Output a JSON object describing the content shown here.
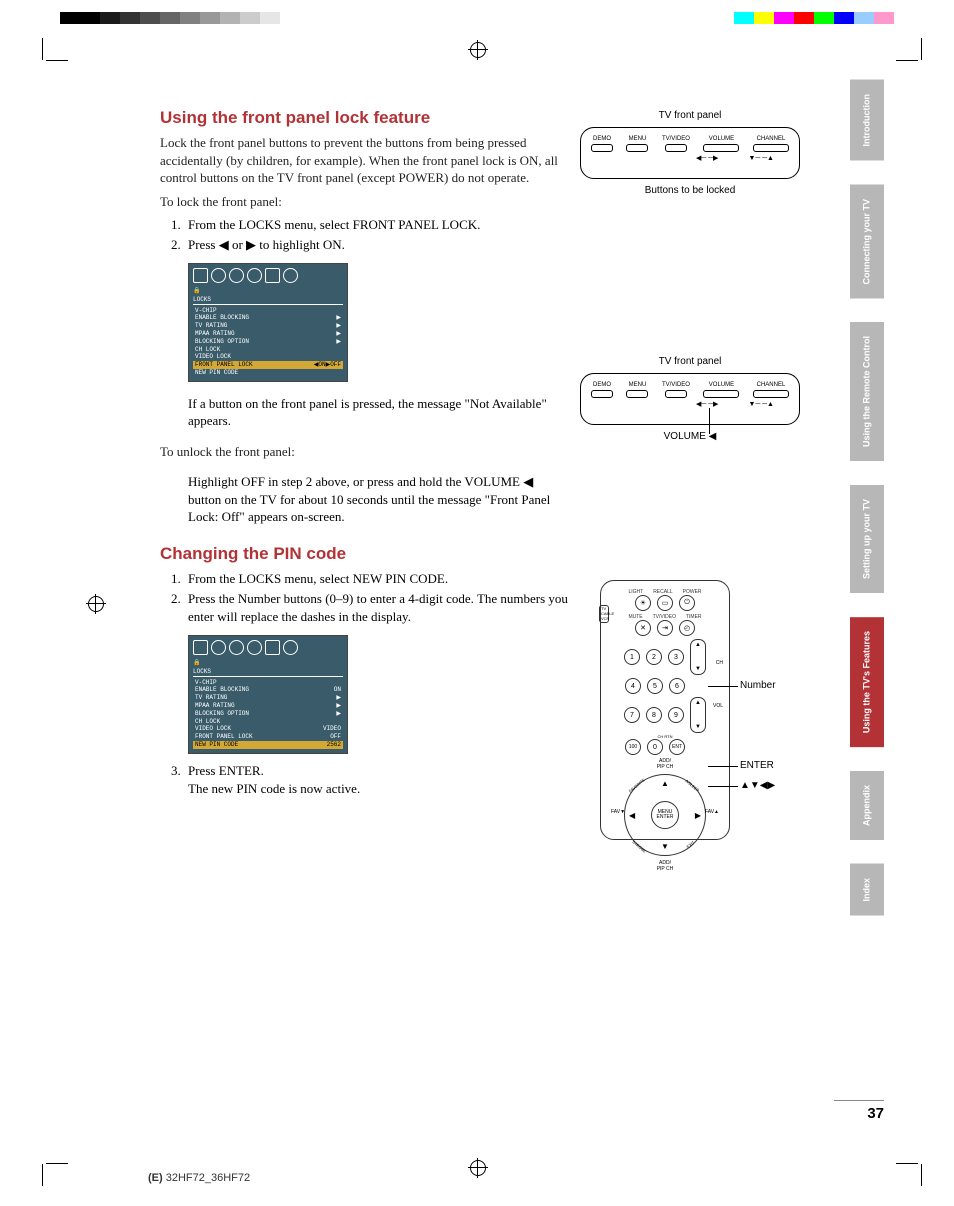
{
  "section1": {
    "title": "Using the front panel lock feature",
    "intro": "Lock the front panel buttons to prevent the buttons from being pressed accidentally (by children, for example). When the front panel lock is ON, all control buttons on the TV front panel (except POWER) do not operate.",
    "lockLead": "To lock the front panel:",
    "step1": "From the LOCKS menu, select FRONT PANEL LOCK.",
    "step2": "Press ◀ or ▶ to highlight ON.",
    "afterImg": "If a button on the front panel is pressed, the message \"Not Available\" appears.",
    "unlockLead": "To unlock the front panel:",
    "unlockPara": "Highlight OFF in step 2 above, or press and hold the VOLUME ◀ button on the TV for about 10 seconds until the message \"Front Panel Lock: Off\" appears on-screen."
  },
  "section2": {
    "title": "Changing the PIN code",
    "step1": "From the LOCKS menu, select NEW PIN CODE.",
    "step2": "Press the Number buttons (0–9) to enter a 4-digit code. The numbers you enter will replace the dashes in the display.",
    "step3": "Press ENTER.",
    "step3b": "The new PIN code is now active."
  },
  "osd1": {
    "title": "LOCKS",
    "rows": [
      {
        "l": "V-CHIP",
        "r": ""
      },
      {
        "l": "  ENABLE BLOCKING",
        "r": "▶"
      },
      {
        "l": "  TV RATING",
        "r": "▶"
      },
      {
        "l": "  MPAA RATING",
        "r": "▶"
      },
      {
        "l": "  BLOCKING OPTION",
        "r": "▶"
      },
      {
        "l": "CH LOCK",
        "r": ""
      },
      {
        "l": "VIDEO LOCK",
        "r": ""
      }
    ],
    "hl": {
      "l": "FRONT PANEL LOCK",
      "r": "◀ON▶OFF"
    },
    "last": {
      "l": "NEW PIN CODE",
      "r": ""
    }
  },
  "osd2": {
    "title": "LOCKS",
    "rows": [
      {
        "l": "V-CHIP",
        "r": ""
      },
      {
        "l": "  ENABLE BLOCKING",
        "r": "ON"
      },
      {
        "l": "  TV RATING",
        "r": "▶"
      },
      {
        "l": "  MPAA RATING",
        "r": "▶"
      },
      {
        "l": "  BLOCKING OPTION",
        "r": "▶"
      },
      {
        "l": "CH LOCK",
        "r": ""
      },
      {
        "l": "VIDEO LOCK",
        "r": "VIDEO"
      },
      {
        "l": "FRONT PANEL LOCK",
        "r": "OFF"
      }
    ],
    "hl": {
      "l": "NEW PIN CODE",
      "r": "2562"
    }
  },
  "panel": {
    "title": "TV front panel",
    "btns": [
      "DEMO",
      "MENU",
      "TV/VIDEO",
      "VOLUME",
      "CHANNEL"
    ],
    "caption1": "Buttons to be locked",
    "caption2": "VOLUME ◀"
  },
  "remote": {
    "topLabels": [
      "LIGHT",
      "RECALL",
      "POWER"
    ],
    "row2Labels": [
      "MUTE",
      "TV/VIDEO",
      "TIMER"
    ],
    "switchLabels": "TV\nCABLE\nVCR",
    "numbers": [
      "1",
      "2",
      "3",
      "4",
      "5",
      "6",
      "7",
      "8",
      "9",
      "100",
      "0",
      "ENT"
    ],
    "chLabel": "CH",
    "volLabel": "VOL",
    "chRtn": "CH RTN",
    "add": "ADD/\nPIP CH",
    "menuEnter": "MENU\nENTER",
    "fav1": "FAV▼",
    "fav2": "FAV▲",
    "favorite": "FAVORITE",
    "asleep": "A/SLEEP",
    "strobe": "STROBE",
    "exit": "EXIT",
    "calloutNumber": "Number",
    "calloutEnter": "ENTER",
    "calloutArrows": "▲▼◀▶"
  },
  "sideTabs": [
    "Introduction",
    "Connecting your TV",
    "Using the Remote Control",
    "Setting up your TV",
    "Using the TV's Features",
    "Appendix",
    "Index"
  ],
  "pageNumber": "37",
  "footerModel": "(E) 32HF72_36HF72"
}
